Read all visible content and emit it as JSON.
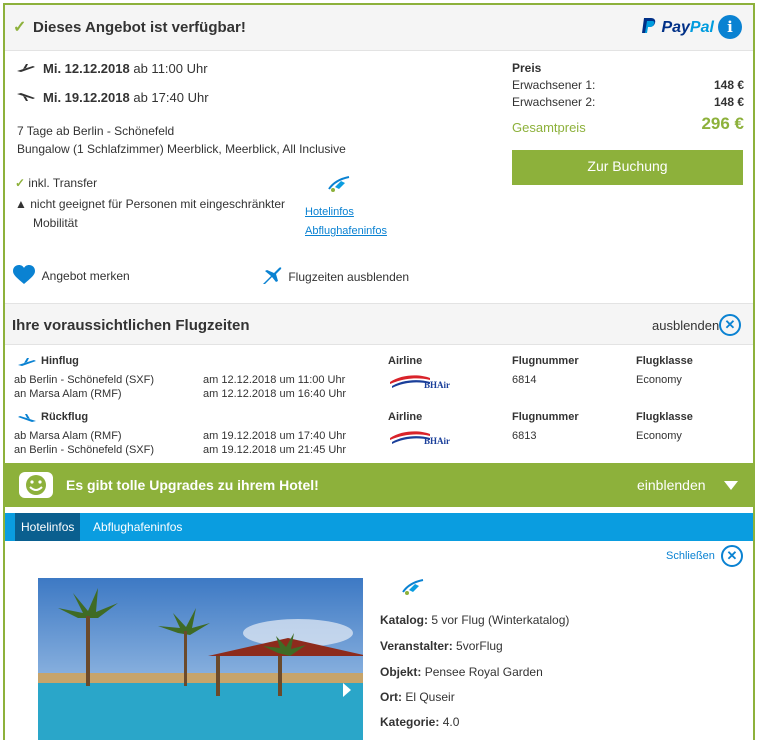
{
  "header": {
    "title": "Dieses Angebot ist verfügbar!",
    "paypal_pay": "Pay",
    "paypal_pal": "Pal",
    "info_symbol": "i"
  },
  "offer": {
    "outbound_date": "Mi. 12.12.2018",
    "outbound_time": "ab 11:00 Uhr",
    "return_date": "Mi. 19.12.2018",
    "return_time": "ab 17:40 Uhr",
    "duration": "7 Tage ab Berlin - Schönefeld",
    "room": "Bungalow (1 Schlafzimmer) Meerblick, Meerblick, All Inclusive",
    "feature_transfer": "inkl. Transfer",
    "feature_mobility": "nicht geeignet für Personen mit eingeschränkter",
    "feature_mobility_2": "Mobilität",
    "link_hotel": "Hotelinfos",
    "link_airport": "Abflughafeninfos",
    "save_offer": "Angebot merken",
    "hide_flights": "Flugzeiten ausblenden"
  },
  "price": {
    "heading": "Preis",
    "adult1_label": "Erwachsener 1:",
    "adult1_value": "148 €",
    "adult2_label": "Erwachsener 2:",
    "adult2_value": "148 €",
    "total_label": "Gesamtpreis",
    "total_value": "296 €",
    "book_button": "Zur Buchung"
  },
  "flights": {
    "section_title": "Ihre voraussichtlichen Flugzeiten",
    "hide_label": "ausblenden",
    "col_airline": "Airline",
    "col_flightno": "Flugnummer",
    "col_class": "Flugklasse",
    "outbound": {
      "label": "Hinflug",
      "from": "ab Berlin - Schönefeld (SXF)",
      "to": "an Marsa Alam (RMF)",
      "dep": "am 12.12.2018 um 11:00 Uhr",
      "arr": "am 12.12.2018 um 16:40 Uhr",
      "flight_number": "6814",
      "flight_class": "Economy",
      "airline_logo": "BHAir"
    },
    "return": {
      "label": "Rückflug",
      "from": "ab Marsa Alam (RMF)",
      "to": "an Berlin - Schönefeld (SXF)",
      "dep": "am 19.12.2018 um 17:40 Uhr",
      "arr": "am 19.12.2018 um 21:45 Uhr",
      "flight_number": "6813",
      "flight_class": "Economy",
      "airline_logo": "BHAir"
    }
  },
  "upgrade": {
    "text": "Es gibt tolle Upgrades zu ihrem Hotel!",
    "action": "einblenden"
  },
  "tabs": [
    {
      "label": "Hotelinfos"
    },
    {
      "label": "Abflughafeninfos"
    }
  ],
  "hotel_info": {
    "close_label": "Schließen",
    "catalog_label": "Katalog:",
    "catalog_value": "5 vor Flug (Winterkatalog)",
    "operator_label": "Veranstalter:",
    "operator_value": "5vorFlug",
    "object_label": "Objekt:",
    "object_value": "Pensee Royal Garden",
    "place_label": "Ort:",
    "place_value": "El Quseir",
    "category_label": "Kategorie:",
    "category_value": "4.0"
  },
  "colors": {
    "accent_green": "#8db13b",
    "accent_blue": "#0a82d2",
    "tab_blue": "#0a9de0"
  }
}
